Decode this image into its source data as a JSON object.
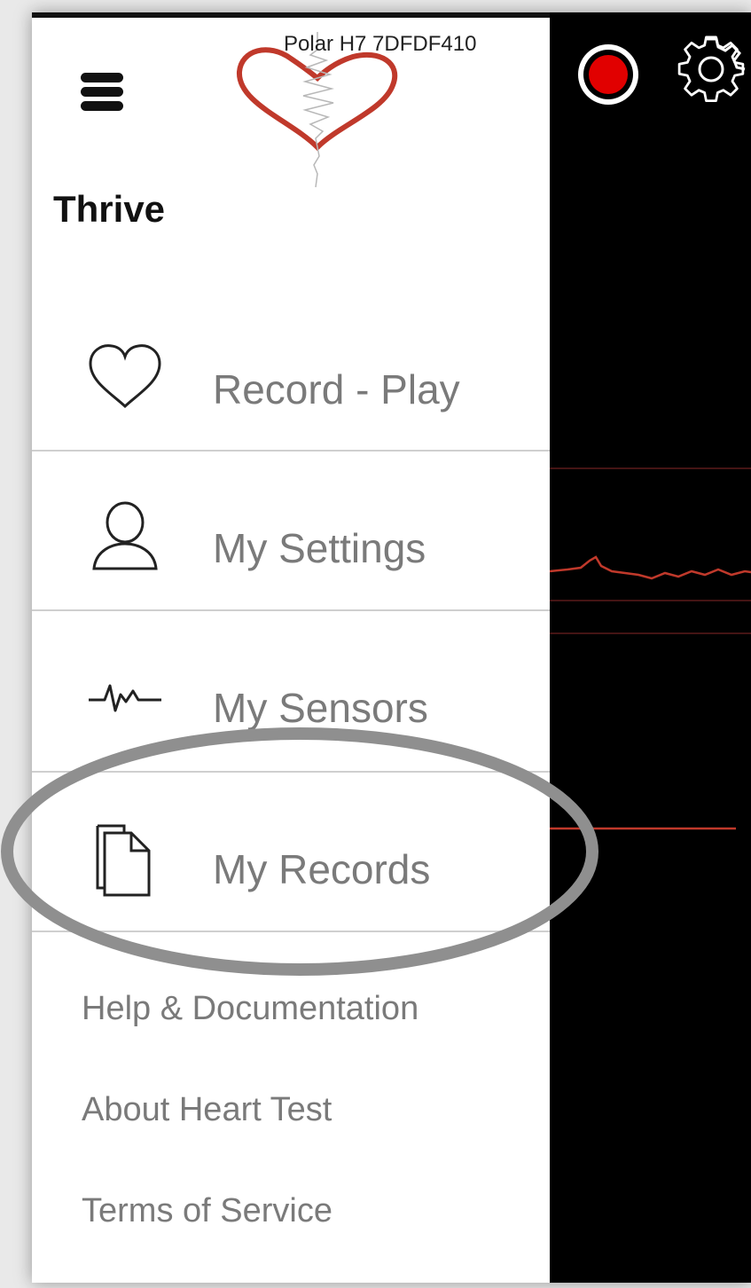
{
  "header": {
    "device_name": "Polar H7 7DFDF410",
    "app_title": "Thrive",
    "logo_icon": "heart-ecg-logo",
    "menu_icon": "hamburger-icon"
  },
  "menu": {
    "items": [
      {
        "label": "Record - Play",
        "icon": "heart-outline-icon"
      },
      {
        "label": "My Settings",
        "icon": "person-outline-icon"
      },
      {
        "label": "My Sensors",
        "icon": "pulse-waveform-icon"
      },
      {
        "label": "My Records",
        "icon": "documents-icon"
      }
    ]
  },
  "links": [
    {
      "label": "Help & Documentation"
    },
    {
      "label": "About Heart Test"
    },
    {
      "label": "Terms of Service"
    }
  ],
  "toolbar": {
    "record_icon": "record-icon",
    "settings_icon": "gear-icon"
  },
  "colors": {
    "accent": "#e10000",
    "trace": "#c0392b",
    "highlight_ring": "#8f8f8f",
    "panel_bg": "#000000",
    "drawer_bg": "#ffffff",
    "menu_text": "#7a7a7a"
  }
}
